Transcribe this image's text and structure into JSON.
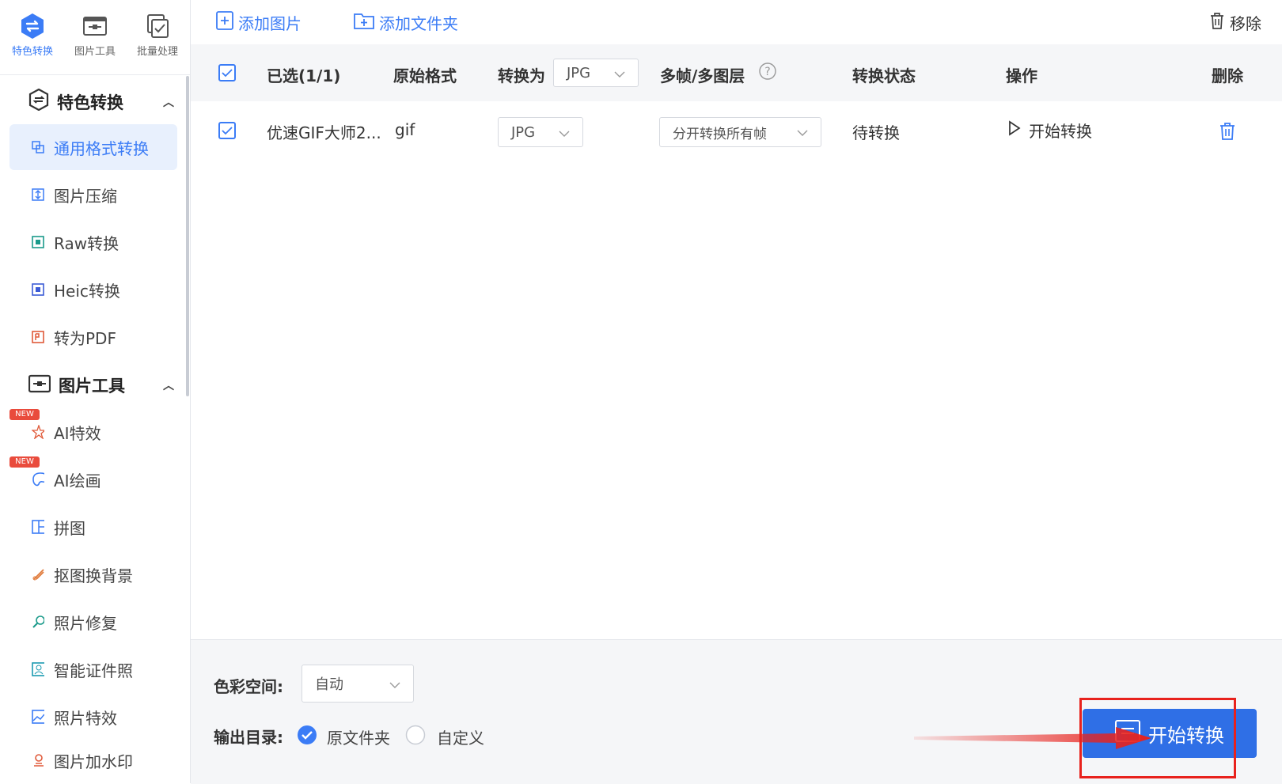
{
  "topnav": [
    {
      "label": "特色转换",
      "icon": "swap-icon",
      "active": true
    },
    {
      "label": "图片工具",
      "icon": "image-tool-icon",
      "active": false
    },
    {
      "label": "批量处理",
      "icon": "batch-icon",
      "active": false
    }
  ],
  "sidebar": {
    "section1": {
      "title": "特色转换",
      "items": [
        {
          "label": "通用格式转换",
          "icon": "format-convert-icon",
          "active": true
        },
        {
          "label": "图片压缩",
          "icon": "compress-icon"
        },
        {
          "label": "Raw转换",
          "icon": "raw-icon"
        },
        {
          "label": "Heic转换",
          "icon": "heic-icon"
        },
        {
          "label": "转为PDF",
          "icon": "pdf-icon"
        }
      ]
    },
    "section2": {
      "title": "图片工具",
      "items": [
        {
          "label": "AI特效",
          "icon": "ai-effect-icon",
          "badge": "NEW"
        },
        {
          "label": "AI绘画",
          "icon": "ai-paint-icon",
          "badge": "NEW"
        },
        {
          "label": "拼图",
          "icon": "collage-icon"
        },
        {
          "label": "抠图换背景",
          "icon": "cutout-icon"
        },
        {
          "label": "照片修复",
          "icon": "repair-icon"
        },
        {
          "label": "智能证件照",
          "icon": "id-photo-icon"
        },
        {
          "label": "照片特效",
          "icon": "photo-effect-icon"
        },
        {
          "label": "图片加水印",
          "icon": "watermark-icon"
        }
      ]
    }
  },
  "toolbar": {
    "add_image": "添加图片",
    "add_folder": "添加文件夹",
    "remove": "移除"
  },
  "table": {
    "headers": {
      "selected": "已选(1/1)",
      "orig_format": "原始格式",
      "convert_to": "转换为",
      "convert_to_value": "JPG",
      "multiframe": "多帧/多图层",
      "status": "转换状态",
      "action": "操作",
      "delete": "删除"
    },
    "rows": [
      {
        "name": "优速GIF大师2...",
        "format": "gif",
        "target": "JPG",
        "frame_mode": "分开转换所有帧",
        "status": "待转换",
        "action": "开始转换"
      }
    ]
  },
  "bottom": {
    "color_space_label": "色彩空间:",
    "color_space_value": "自动",
    "output_label": "输出目录:",
    "output_opt1": "原文件夹",
    "output_opt2": "自定义",
    "start": "开始转换"
  },
  "colors": {
    "accent": "#3b7cf6",
    "annotation": "#e8221d"
  }
}
